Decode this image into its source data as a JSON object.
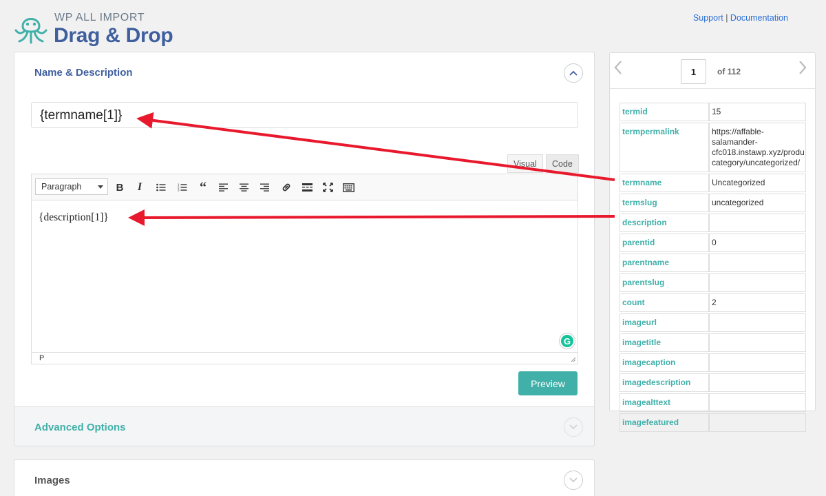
{
  "header": {
    "brand_top": "WP ALL IMPORT",
    "brand_main": "Drag & Drop",
    "support_link": "Support",
    "separator": "|",
    "documentation_link": "Documentation"
  },
  "name_panel": {
    "title": "Name & Description",
    "name_value": "{termname[1]}",
    "tab_visual": "Visual",
    "tab_code": "Code",
    "format_select": "Paragraph",
    "description_value": "{description[1]}",
    "path_label": "P",
    "preview_button": "Preview"
  },
  "advanced_panel": {
    "title": "Advanced Options"
  },
  "images_panel": {
    "title": "Images"
  },
  "pager": {
    "current_page": "1",
    "of_label": "of 112"
  },
  "fields": [
    {
      "key": "termid",
      "value": "15"
    },
    {
      "key": "termpermalink",
      "value": "https://affable-\nsalamander-\ncfc018.instawp.xyz/produ\ncategory/uncategorized/"
    },
    {
      "key": "termname",
      "value": "Uncategorized"
    },
    {
      "key": "termslug",
      "value": "uncategorized"
    },
    {
      "key": "description",
      "value": ""
    },
    {
      "key": "parentid",
      "value": "0"
    },
    {
      "key": "parentname",
      "value": ""
    },
    {
      "key": "parentslug",
      "value": ""
    },
    {
      "key": "count",
      "value": "2"
    },
    {
      "key": "imageurl",
      "value": ""
    },
    {
      "key": "imagetitle",
      "value": ""
    },
    {
      "key": "imagecaption",
      "value": ""
    },
    {
      "key": "imagedescription",
      "value": ""
    },
    {
      "key": "imagealttext",
      "value": ""
    },
    {
      "key": "imagefeatured",
      "value": ""
    }
  ],
  "icons": {
    "bold": "bold-icon",
    "italic": "italic-icon",
    "bullet_list": "bullet-list-icon",
    "numbered_list": "numbered-list-icon",
    "quote": "blockquote-icon",
    "align_left": "align-left-icon",
    "align_center": "align-center-icon",
    "align_right": "align-right-icon",
    "link": "link-icon",
    "more": "read-more-icon",
    "fullscreen": "fullscreen-icon",
    "kitchen_sink": "toolbar-toggle-icon"
  },
  "colors": {
    "accent": "#40b0a9",
    "brand": "#3f5f9e",
    "arrow": "#e8192c"
  }
}
